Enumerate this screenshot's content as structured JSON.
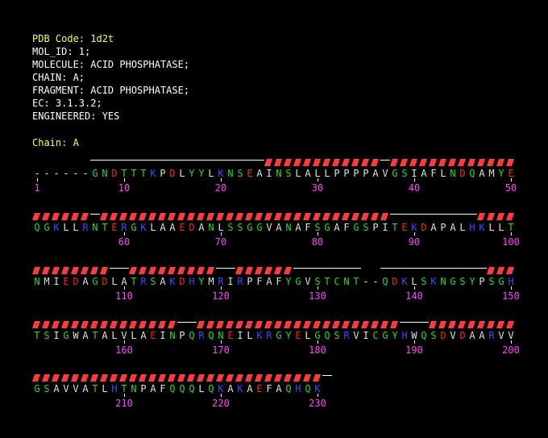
{
  "colors": {
    "background": "#000000",
    "header_text": "#ffffff",
    "pdb_code": "#ffff40",
    "chain_label": "#ffff40",
    "numbers": "#ff40ff",
    "helix": "#ff3b3b",
    "coil": "#ffffff",
    "res_hydrophobic": "#e0e0e0",
    "res_polar": "#22dd22",
    "res_acidic": "#ff2020",
    "res_basic": "#3a4cff",
    "gap": "#ffffff"
  },
  "header": {
    "pdb_code": "PDB Code: 1d2t",
    "lines": [
      "MOL_ID: 1;",
      "MOLECULE: ACID PHOSPHATASE;",
      "CHAIN: A;",
      "FRAGMENT: ACID PHOSPHATASE;",
      "EC: 3.1.3.2;",
      "ENGINEERED: YES"
    ],
    "chain_label": "Chain: A"
  },
  "rows": [
    {
      "sequence": "------GNDTTTKPDLYYLKNSEAINSLALLPPPPAVGSIAFLNDQAMYE",
      "numbers": [
        "1",
        "10",
        "20",
        "30",
        "40",
        "50"
      ],
      "ss": "------CCCCCCCCCCCCCCCCCCHHHHHHHHHHHHCHHHHHHHHHHHHHHHHH"
    },
    {
      "sequence": "QGKLLRNTERGKLAAEDANLSSGGVANAFSGAFGSPITEKDAPALHKLLT",
      "numbers": [
        "60",
        "70",
        "80",
        "90",
        "100"
      ],
      "ss": "HHHHHHCHHHHHHHHHHHHHHHHHHHHHHHHHHHHHHCCCCCCCCCHHHHHHHHH"
    },
    {
      "sequence": "NMIEDAGDLATRSAKDHYMRIRPFAFYGVSTCNT--QDKLSKNGSYPSGH",
      "numbers": [
        "110",
        "120",
        "130",
        "140",
        "150"
      ],
      "ss": "HHHHHHHHCCHHHHHHHHHCCHHHHHHCCCCCCC  CCCCCCCCCCCHHH"
    },
    {
      "sequence": "TSIGWATALVLAEINPQRQNEILKRGYELGQSRVICGYHWQSDVDAARVV",
      "numbers": [
        "160",
        "170",
        "180",
        "190",
        "200"
      ],
      "ss": "HHHHHHHHHHHHHHHCCHHHHHHHHHHHHHHHHHHHHHCCCHHHHHHHHHH"
    },
    {
      "sequence": "GSAVVATLHTNPAFQQQLQKAKAEFAQHQK",
      "numbers": [
        "210",
        "220",
        "230"
      ],
      "ss": "HHHHHHHHHHHHHHHHHHHHHHHHHHHHHHC"
    }
  ]
}
